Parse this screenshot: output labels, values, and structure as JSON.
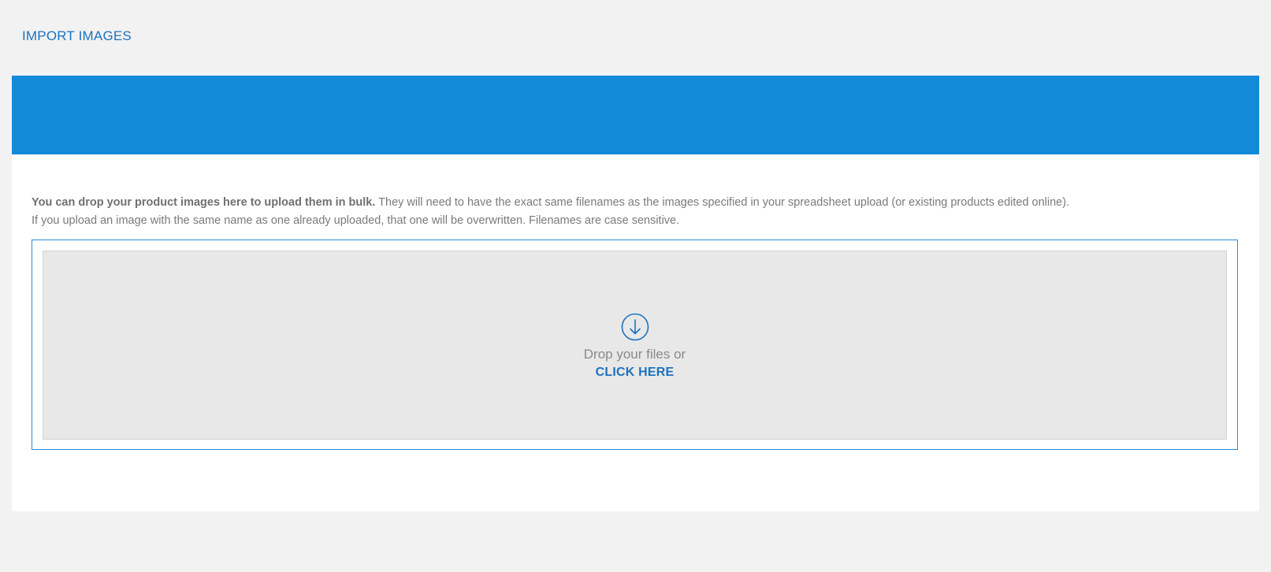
{
  "header": {
    "title": "IMPORT IMAGES"
  },
  "intro": {
    "bold": "You can drop your product images here to upload them in bulk.",
    "line1_rest": " They will need to have the exact same filenames as the images specified in your spreadsheet upload (or existing products edited online).",
    "line2": "If you upload an image with the same name as one already uploaded, that one will be overwritten. Filenames are case sensitive."
  },
  "dropzone": {
    "icon": "download-circle-icon",
    "text": "Drop your files or",
    "link_label": "CLICK HERE"
  },
  "colors": {
    "accent": "#1a73bf",
    "banner": "#138ad8",
    "dropzone_border": "#2a8fdb",
    "dropzone_bg": "#e8e8e8"
  }
}
